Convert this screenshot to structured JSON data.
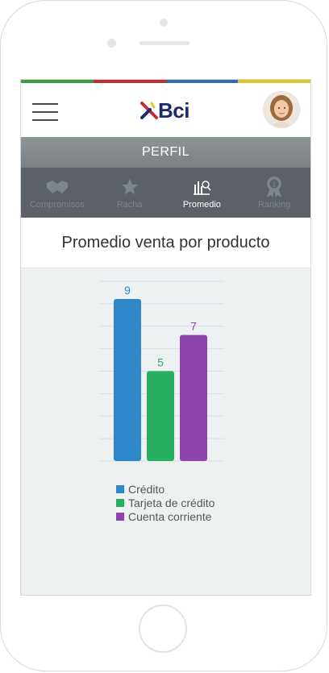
{
  "header": {
    "logo_text": "Bci",
    "colors": [
      "#3a9d3a",
      "#c22c35",
      "#2e6ea8",
      "#e3c42b"
    ]
  },
  "profile": {
    "title": "PERFIL"
  },
  "tabs": [
    {
      "label": "Compromisos",
      "icon": "handshake-icon",
      "active": false
    },
    {
      "label": "Racha",
      "icon": "star-icon",
      "active": false
    },
    {
      "label": "Promedio",
      "icon": "chart-icon",
      "active": true
    },
    {
      "label": "Ranking",
      "icon": "medal-icon",
      "active": false
    }
  ],
  "page": {
    "title": "Promedio venta por producto"
  },
  "chart_data": {
    "type": "bar",
    "categories": [
      "Crédito",
      "Tarjeta de crédito",
      "Cuenta corriente"
    ],
    "values": [
      9,
      5,
      7
    ],
    "data_labels": [
      "9",
      "5",
      "7"
    ],
    "colors": [
      "#2d87c9",
      "#27ae60",
      "#8e44ad"
    ],
    "ylim": [
      0,
      9
    ],
    "grid": true,
    "legend_position": "bottom"
  }
}
